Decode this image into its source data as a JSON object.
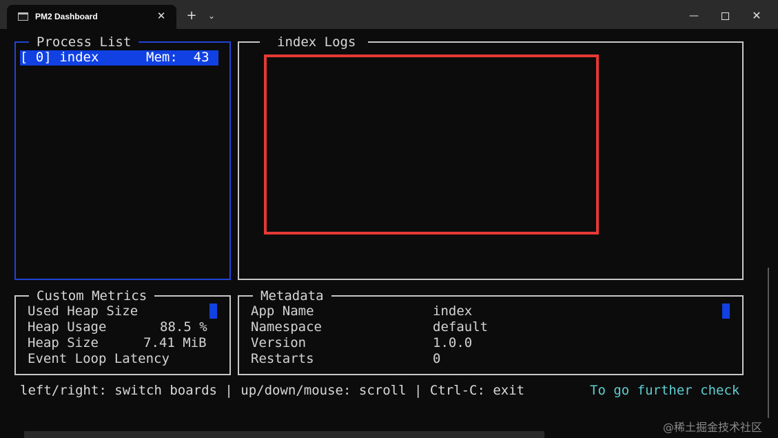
{
  "window": {
    "tab_title": "PM2 Dashboard",
    "tab_close": "✕",
    "new_tab": "+",
    "tab_dropdown": "⌄",
    "minimize": "—",
    "close": "✕"
  },
  "process_list": {
    "title": "Process List",
    "rows": [
      {
        "text": "[ 0] index      Mem:  43"
      }
    ]
  },
  "logs": {
    "title": "index Logs"
  },
  "custom_metrics": {
    "title": "Custom Metrics",
    "rows": [
      {
        "label": "Used Heap Size",
        "value": ""
      },
      {
        "label": "Heap Usage",
        "value": "88.5 %"
      },
      {
        "label": "Heap Size",
        "value": "7.41 MiB"
      },
      {
        "label": "Event Loop Latency",
        "value": ""
      }
    ]
  },
  "metadata": {
    "title": "Metadata",
    "rows": [
      {
        "key": "App Name",
        "value": "index"
      },
      {
        "key": "Namespace",
        "value": "default"
      },
      {
        "key": "Version",
        "value": "1.0.0"
      },
      {
        "key": "Restarts",
        "value": "0"
      }
    ]
  },
  "help": {
    "text": "left/right: switch boards | up/down/mouse: scroll | Ctrl-C: exit",
    "link": "To go further check"
  },
  "watermark": "@稀土掘金技术社区",
  "colors": {
    "highlight": "#1141e3",
    "annotation_rect": "#e53935",
    "link": "#5fcdd0"
  }
}
